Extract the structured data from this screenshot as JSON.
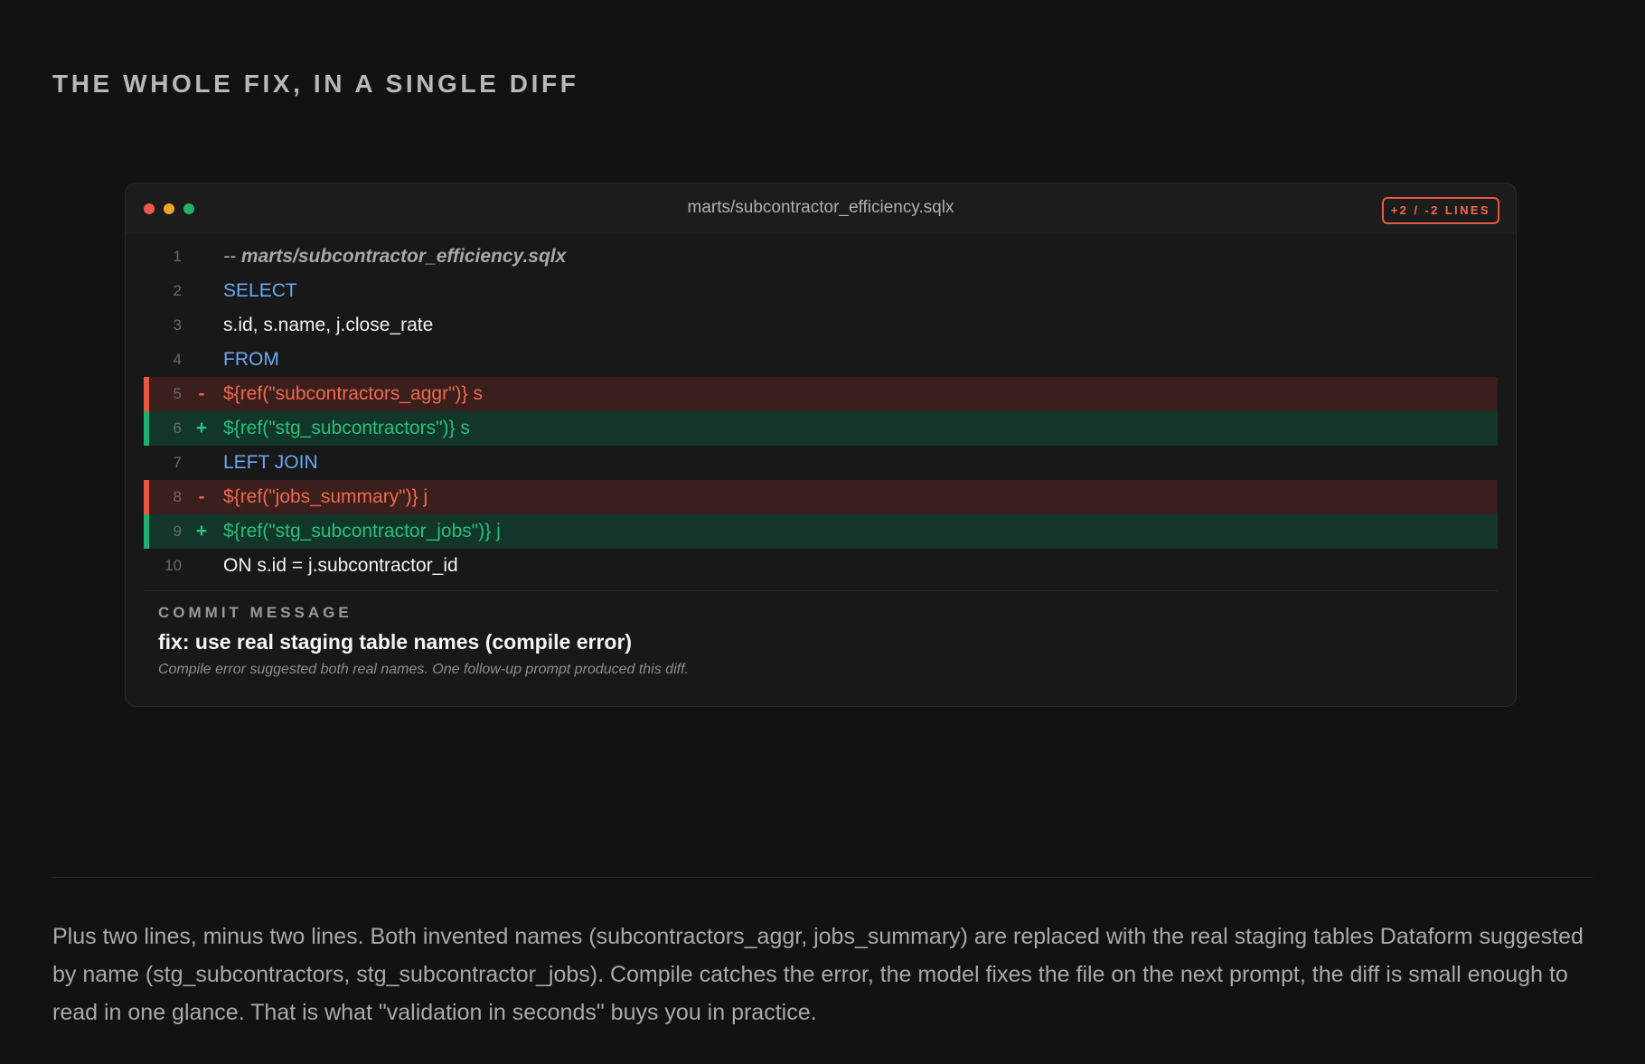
{
  "page": {
    "title": "THE WHOLE FIX, IN A SINGLE DIFF"
  },
  "diff": {
    "filename": "marts/subcontractor_efficiency.sqlx",
    "badge": "+2 / -2 LINES",
    "window_buttons": [
      "close",
      "minimize",
      "maximize"
    ],
    "lines": [
      {
        "num": "1",
        "type": "context",
        "marker": "",
        "text": "-- marts/subcontractor_efficiency.sqlx",
        "style": "comment"
      },
      {
        "num": "2",
        "type": "context",
        "marker": "",
        "text": "SELECT",
        "style": "keyword"
      },
      {
        "num": "3",
        "type": "context",
        "marker": "",
        "text": "s.id, s.name, j.close_rate",
        "style": "plain"
      },
      {
        "num": "4",
        "type": "context",
        "marker": "",
        "text": "FROM",
        "style": "keyword"
      },
      {
        "num": "5",
        "type": "del",
        "marker": "-",
        "text": "${ref(\"subcontractors_aggr\")} s",
        "style": "del"
      },
      {
        "num": "6",
        "type": "add",
        "marker": "+",
        "text": "${ref(\"stg_subcontractors\")} s",
        "style": "add"
      },
      {
        "num": "7",
        "type": "context",
        "marker": "",
        "text": "LEFT JOIN",
        "style": "keyword"
      },
      {
        "num": "8",
        "type": "del",
        "marker": "-",
        "text": "${ref(\"jobs_summary\")} j",
        "style": "del"
      },
      {
        "num": "9",
        "type": "add",
        "marker": "+",
        "text": "${ref(\"stg_subcontractor_jobs\")} j",
        "style": "add"
      },
      {
        "num": "10",
        "type": "context",
        "marker": "",
        "text": "ON s.id = j.subcontractor_id",
        "style": "plain"
      }
    ],
    "commit": {
      "label": "COMMIT MESSAGE",
      "title": "fix: use real staging table names (compile error)",
      "body": "Compile error suggested both real names. One follow-up prompt produced this diff."
    }
  },
  "summary": "Plus two lines, minus two lines. Both invented names (subcontractors_aggr, jobs_summary) are replaced with the real staging tables Dataform suggested by name (stg_subcontractors, stg_subcontractor_jobs). Compile catches the error, the model fixes the file on the next prompt, the diff is small enough to read in one glance. That is what \"validation in seconds\" buys you in practice.",
  "colors": {
    "background": "#121212",
    "del_accent": "#e8573f",
    "add_accent": "#1fae6f",
    "keyword": "#6aa8f0"
  }
}
